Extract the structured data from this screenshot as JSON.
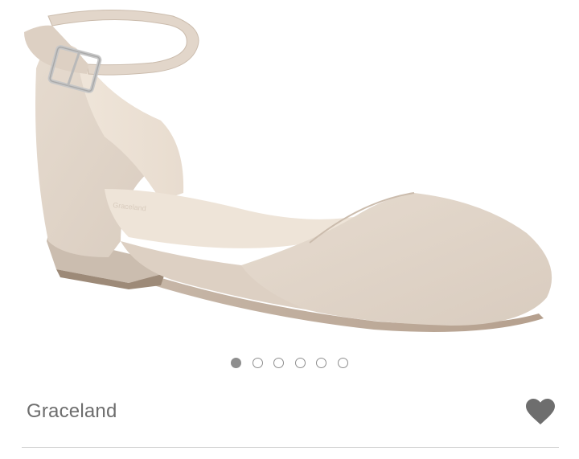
{
  "product": {
    "name": "Graceland",
    "wishlisted": true
  },
  "gallery": {
    "image_count": 6,
    "active_index": 0
  },
  "colors": {
    "shoe_suede": "#e1d5c9",
    "shoe_shadow": "#cdbfb2",
    "lining": "#eadfd3",
    "heart": "#6e6e6e",
    "dot": "#8e8e8e",
    "name_text": "#6d6d6d",
    "divider": "#cfcfcf"
  },
  "icons": {
    "wishlist": "heart-icon"
  }
}
